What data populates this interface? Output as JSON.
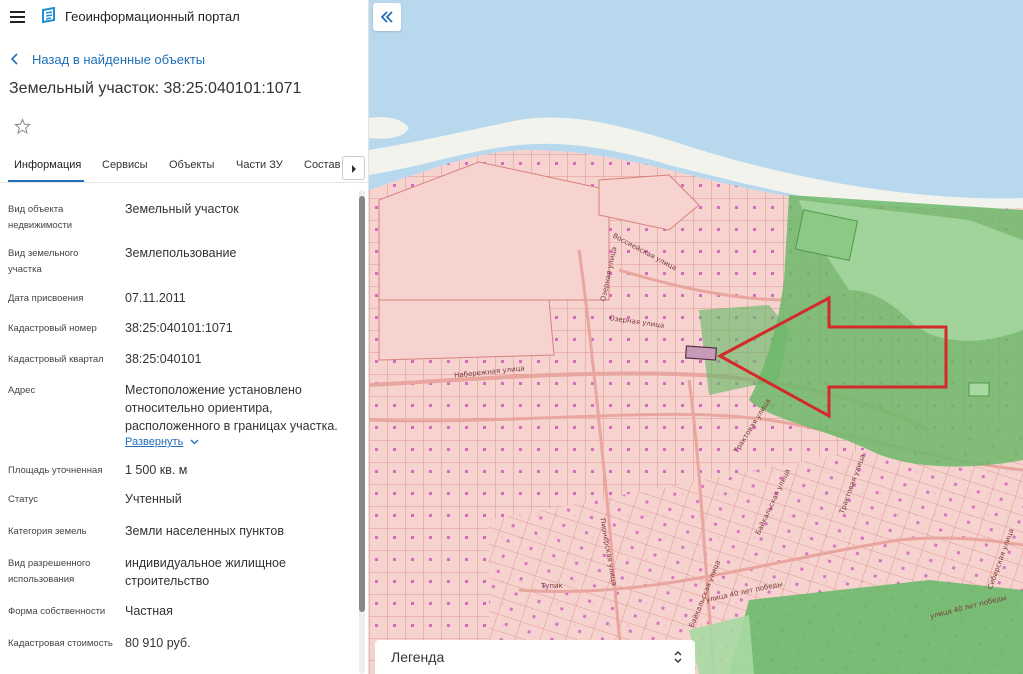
{
  "app": {
    "title": "Геоинформационный портал"
  },
  "nav": {
    "back_label": "Назад в найденные объекты"
  },
  "object": {
    "title": "Земельный участок: 38:25:040101:1071"
  },
  "tabs": [
    {
      "label": "Информация"
    },
    {
      "label": "Сервисы"
    },
    {
      "label": "Объекты"
    },
    {
      "label": "Части ЗУ"
    },
    {
      "label": "Состав"
    }
  ],
  "properties": [
    {
      "label": "Вид объекта недвижимости",
      "value": "Земельный участок"
    },
    {
      "label": "Вид земельного участка",
      "value": "Землепользование"
    },
    {
      "label": "Дата присвоения",
      "value": "07.11.2011"
    },
    {
      "label": "Кадастровый номер",
      "value": "38:25:040101:1071"
    },
    {
      "label": "Кадастровый квартал",
      "value": "38:25:040101"
    },
    {
      "label": "Адрес",
      "value": "Местоположение установлено относительно ориентира, расположенного в границах участка."
    },
    {
      "label": "Площадь уточненная",
      "value": "1 500 кв. м"
    },
    {
      "label": "Статус",
      "value": "Учтенный"
    },
    {
      "label": "Категория земель",
      "value": "Земли населенных пунктов"
    },
    {
      "label": "Вид разрешенного использования",
      "value": "индивидуальное жилищное строительство"
    },
    {
      "label": "Форма собственности",
      "value": "Частная"
    },
    {
      "label": "Кадастровая стоимость",
      "value": "80 910 руб."
    }
  ],
  "address_expand_label": "Развернуть",
  "map": {
    "streets": [
      "Воссиейская улица",
      "Озерная улица",
      "Озерная улица",
      "Набережная улица",
      "Трактовая улица",
      "Байкальская улица",
      "улица 40 лет победы",
      "Байкальская улица",
      "улица 40 лет победы",
      "Пионерская улица",
      "Сибирская улица",
      "Трактовая улица",
      "Тупик"
    ],
    "legend_label": "Легенда"
  },
  "colors": {
    "accent": "#1f6fb8",
    "water": "#b8d8ee",
    "parcels": "#f6d3cf",
    "parcel_lines": "#d9807a",
    "forest": "#6cb96a",
    "arrow": "#d42a2a",
    "selected_parcel": "#c79bb8"
  },
  "icons": [
    "menu-icon",
    "portal-logo-icon",
    "chevron-left-icon",
    "star-icon",
    "chevron-right-icon",
    "chevron-down-icon",
    "double-chevron-left-icon",
    "updown-chevron-icon"
  ]
}
